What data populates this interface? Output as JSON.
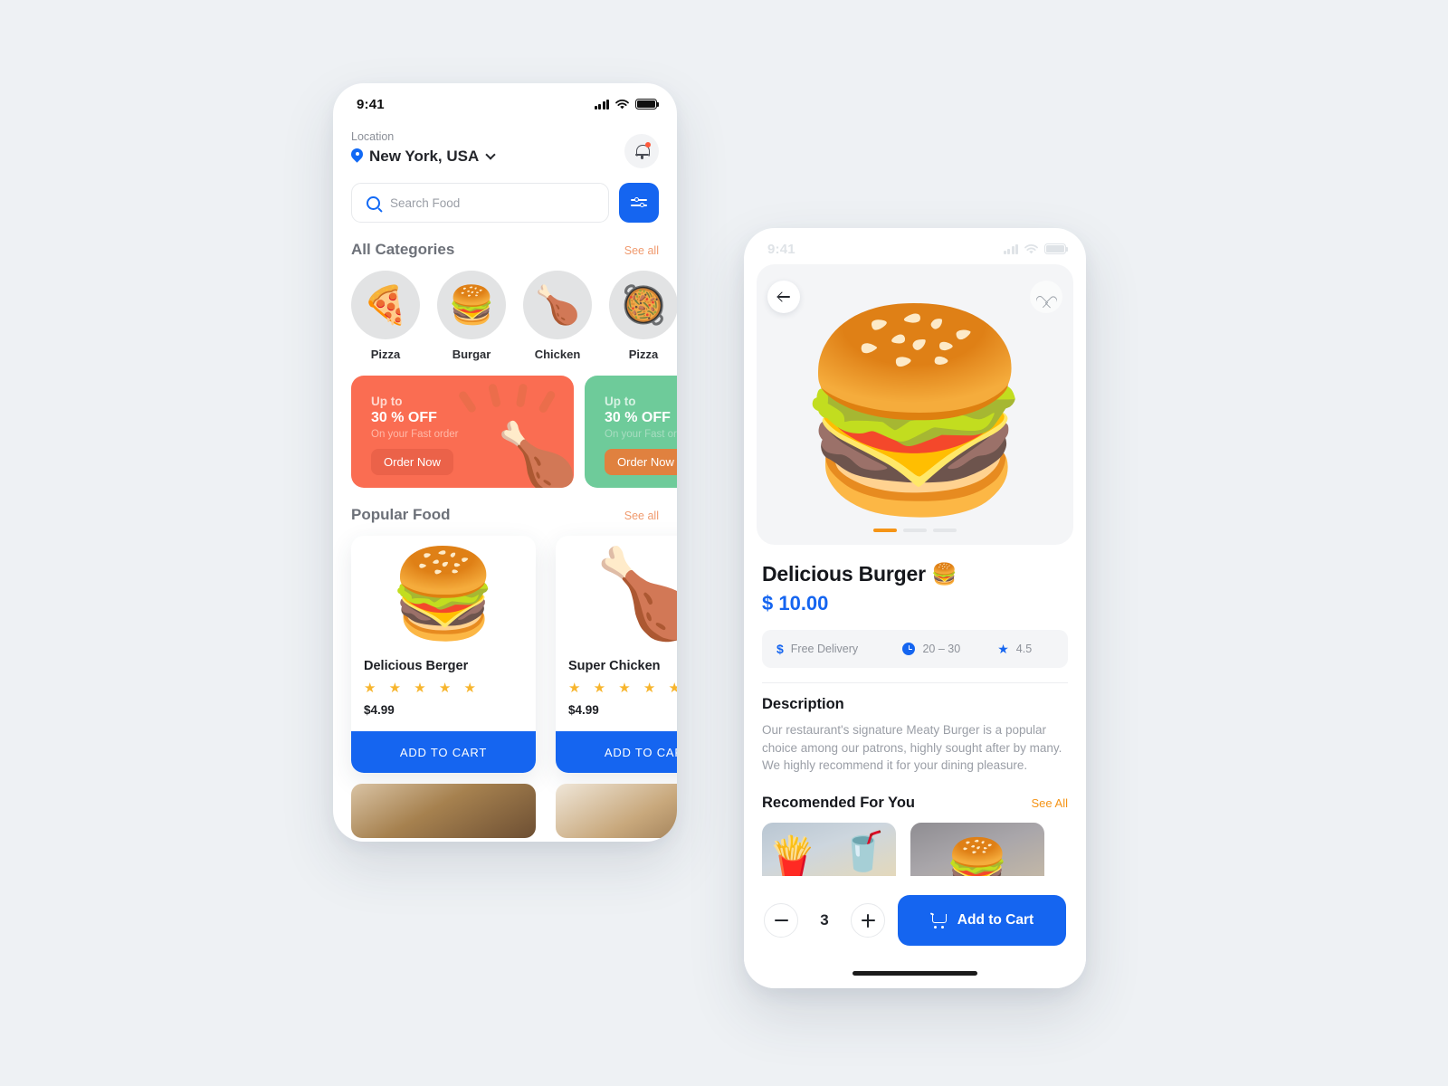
{
  "home": {
    "status": {
      "time": "9:41",
      "signal_icon": "cellular-bars-icon",
      "wifi_icon": "wifi-icon",
      "battery_icon": "battery-icon"
    },
    "location": {
      "label": "Location",
      "city": "New York, USA",
      "pin_icon": "location-pin-icon",
      "chevron_icon": "chevron-down-icon"
    },
    "notification": {
      "icon": "bell-icon",
      "has_badge": true
    },
    "search": {
      "placeholder": "Search Food",
      "value": "",
      "icon": "search-icon"
    },
    "filter": {
      "icon": "sliders-icon",
      "color": "#1565f0"
    },
    "categories_section": {
      "title": "All Categories",
      "see_all": "See all"
    },
    "categories": [
      {
        "label": "Pizza",
        "emoji": "🍕"
      },
      {
        "label": "Burgar",
        "emoji": "🍔"
      },
      {
        "label": "Chicken",
        "emoji": "🍗"
      },
      {
        "label": "Pizza",
        "emoji": "🥘"
      }
    ],
    "banners": [
      {
        "up": "Up to",
        "off": "30 % OFF",
        "sub": "On your Fast order",
        "cta": "Order Now",
        "color": "#fa6d52",
        "art": "🍗"
      },
      {
        "up": "Up to",
        "off": "30 % OFF",
        "sub": "On your Fast or",
        "cta": "Order Now",
        "color": "#6ecb9a",
        "art": ""
      }
    ],
    "popular_section": {
      "title": "Popular Food",
      "see_all": "See all"
    },
    "popular": [
      {
        "name": "Delicious Berger",
        "stars": "★ ★ ★ ★ ★",
        "price": "$4.99",
        "cta": "ADD TO CART",
        "emoji": "🍔",
        "fav_icon": "heart-icon"
      },
      {
        "name": "Super Chicken",
        "stars": "★ ★ ★ ★ ★",
        "price": "$4.99",
        "cta": "ADD TO CART",
        "emoji": "🍗",
        "fav_icon": "heart-icon"
      }
    ]
  },
  "detail": {
    "status": {
      "time": "9:41",
      "signal_icon": "cellular-bars-icon",
      "wifi_icon": "wifi-icon",
      "battery_icon": "battery-icon"
    },
    "back_icon": "arrow-left-icon",
    "fav_icon": "heart-icon",
    "hero_emoji": "🍔",
    "carousel": {
      "total": 3,
      "active": 1,
      "active_color": "#f59416"
    },
    "title": "Delicious Burger 🍔",
    "price": "$ 10.00",
    "price_color": "#1565f0",
    "info": [
      {
        "icon": "dollar-icon",
        "text": "Free Delivery"
      },
      {
        "icon": "clock-icon",
        "text": "20 – 30"
      },
      {
        "icon": "star-icon",
        "text": "4.5"
      }
    ],
    "description_title": "Description",
    "description": "Our restaurant's signature Meaty Burger is a popular choice among our patrons, highly sought after by many. We highly recommend it for your dining pleasure.",
    "recommended_title": "Recomended For You",
    "recommended_see_all": "See All",
    "recommended": [
      {
        "name": "fries-shake-burger"
      },
      {
        "name": "cheese-burger"
      }
    ],
    "quantity": {
      "value": "3",
      "minus_icon": "minus-icon",
      "plus_icon": "plus-icon"
    },
    "cart": {
      "label": "Add to Cart",
      "icon": "shopping-cart-icon",
      "color": "#1565f0"
    }
  }
}
